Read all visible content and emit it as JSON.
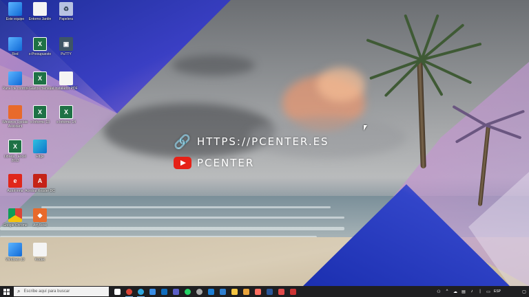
{
  "overlay": {
    "url_text": "HTTPS://PCENTER.ES",
    "channel_text": "PCENTER",
    "link_icon": "link-icon",
    "youtube_icon": "youtube-icon"
  },
  "desktop_icons": [
    {
      "label": "Este equipo",
      "icon": "pc-icon"
    },
    {
      "label": "Entorno Jardin",
      "icon": "document-icon"
    },
    {
      "label": "Papelera",
      "icon": "recycle-bin-icon"
    },
    {
      "label": "Red",
      "icon": "network-icon"
    },
    {
      "label": "x-Presupuesto",
      "icon": "excel-icon"
    },
    {
      "label": "PuTTY",
      "icon": "putty-icon"
    },
    {
      "label": "Panel de control",
      "icon": "control-panel-icon"
    },
    {
      "label": "x-Gastos mensual",
      "icon": "excel-icon"
    },
    {
      "label": "Instalador PDF",
      "icon": "document-icon"
    },
    {
      "label": "Windows Update Assistant",
      "icon": "windows-icon"
    },
    {
      "label": "x-Informe 13",
      "icon": "excel-icon"
    },
    {
      "label": "x-Informe 14",
      "icon": "excel-icon"
    },
    {
      "label": "Libreta - Excel 2013",
      "icon": "excel-icon"
    },
    {
      "label": "Edge",
      "icon": "edge-icon"
    },
    {
      "label": "AutoFirma",
      "icon": "autofirma-icon"
    },
    {
      "label": "Acrobat Reader DC",
      "icon": "pdf-icon"
    },
    {
      "label": "Google Chrome",
      "icon": "chrome-icon"
    },
    {
      "label": "AnyDesk",
      "icon": "anydesk-icon"
    },
    {
      "label": "Windows 10",
      "icon": "windows-icon"
    },
    {
      "label": "Kodak",
      "icon": "document-icon"
    }
  ],
  "taskbar": {
    "search_placeholder": "Escribe aquí para buscar",
    "apps": [
      {
        "name": "task-view-icon",
        "color": "#ffffff"
      },
      {
        "name": "chrome-icon",
        "color": "#db4437"
      },
      {
        "name": "edge-icon",
        "color": "#2fa8e0"
      },
      {
        "name": "store-icon",
        "color": "#3a8ee6"
      },
      {
        "name": "mail-icon",
        "color": "#0f6cbd"
      },
      {
        "name": "teams-icon",
        "color": "#5b5fc7"
      },
      {
        "name": "whatsapp-icon",
        "color": "#25d366"
      },
      {
        "name": "settings-icon",
        "color": "#aaaaaa"
      },
      {
        "name": "photos-icon",
        "color": "#1c7fd6"
      },
      {
        "name": "onedrive-icon",
        "color": "#2f80d1"
      },
      {
        "name": "explorer-icon",
        "color": "#f4c542"
      },
      {
        "name": "maps-icon",
        "color": "#e8a33b"
      },
      {
        "name": "paint-icon",
        "color": "#ff6f61"
      },
      {
        "name": "word-icon",
        "color": "#2b579a"
      },
      {
        "name": "snip-icon",
        "color": "#e24a4a"
      },
      {
        "name": "video-icon",
        "color": "#c33"
      }
    ],
    "tray": {
      "language": "ESP",
      "time": "",
      "date": ""
    }
  }
}
